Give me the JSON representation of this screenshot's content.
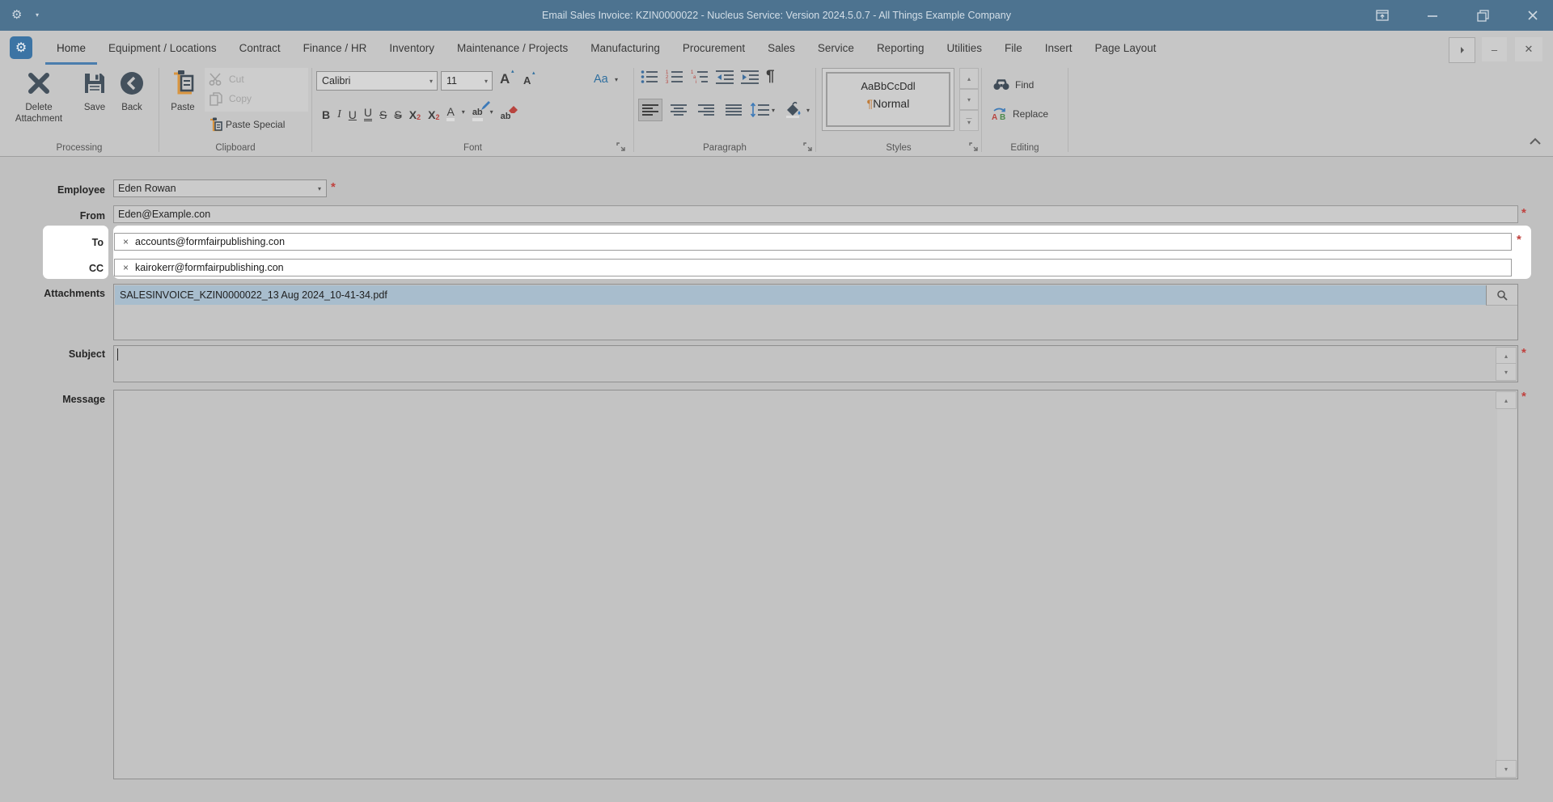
{
  "window": {
    "title": "Email Sales Invoice: KZIN0000022 - Nucleus Service: Version 2024.5.0.7 - All Things Example Company"
  },
  "ribbon": {
    "tabs": [
      "Home",
      "Equipment / Locations",
      "Contract",
      "Finance / HR",
      "Inventory",
      "Maintenance / Projects",
      "Manufacturing",
      "Procurement",
      "Sales",
      "Service",
      "Reporting",
      "Utilities",
      "File",
      "Insert",
      "Page Layout"
    ],
    "selected_tab": "Home",
    "processing": {
      "title": "Processing",
      "delete_attachment": "Delete Attachment",
      "save": "Save",
      "back": "Back"
    },
    "clipboard": {
      "title": "Clipboard",
      "paste": "Paste",
      "cut": "Cut",
      "copy": "Copy",
      "paste_special": "Paste Special"
    },
    "font": {
      "title": "Font",
      "family": "Calibri",
      "size": "11",
      "grow": "A",
      "shrink": "A",
      "change_case": "Aa",
      "bold": "B",
      "italic": "I",
      "underline": "U",
      "double_underline": "U",
      "strikethrough": "S",
      "double_strikethrough": "S",
      "superscript_base": "X",
      "superscript_exp": "2",
      "subscript_base": "X",
      "subscript_exp": "2",
      "font_color": "A",
      "highlight": "ab",
      "clear_formatting": "ab"
    },
    "paragraph": {
      "title": "Paragraph",
      "pilcrow": "¶"
    },
    "styles": {
      "title": "Styles",
      "preview": "AaBbCcDdl",
      "pilcrow": "¶",
      "style_name": "Normal"
    },
    "editing": {
      "title": "Editing",
      "find": "Find",
      "replace": "Replace"
    }
  },
  "form": {
    "required_marker": "*",
    "employee": {
      "label": "Employee",
      "value": "Eden Rowan"
    },
    "from": {
      "label": "From",
      "value": "Eden@Example.con"
    },
    "to": {
      "label": "To",
      "value": "accounts@formfairpublishing.con",
      "remove_glyph": "×"
    },
    "cc": {
      "label": "CC",
      "value": "kairokerr@formfairpublishing.con",
      "remove_glyph": "×"
    },
    "attachments": {
      "label": "Attachments",
      "files": [
        "SALESINVOICE_KZIN0000022_13 Aug 2024_10-41-34.pdf"
      ]
    },
    "subject": {
      "label": "Subject",
      "value": ""
    },
    "message": {
      "label": "Message",
      "value": ""
    }
  },
  "icons": {
    "titlebar_gear": "gear-icon",
    "app_gear": "gear-icon",
    "dock_panel": "dock-panel-icon",
    "minimize": "minimize-icon",
    "restore": "restore-icon",
    "close": "close-icon",
    "delete": "delete-x-icon",
    "save": "floppy-disk-icon",
    "back": "back-circle-icon",
    "paste": "clipboard-icon",
    "cut": "scissors-icon",
    "copy": "copy-pages-icon",
    "find": "binoculars-icon",
    "replace": "replace-ab-icon",
    "search": "magnifier-icon"
  },
  "colors": {
    "titlebar": "#4d7390",
    "accent_blue": "#4a7dad",
    "required_red": "#c0413e",
    "highlight_white": "#ffffff",
    "attachment_selected": "#a8bdcd",
    "icon_dark": "#44515d",
    "icon_orange": "#d9953f"
  }
}
